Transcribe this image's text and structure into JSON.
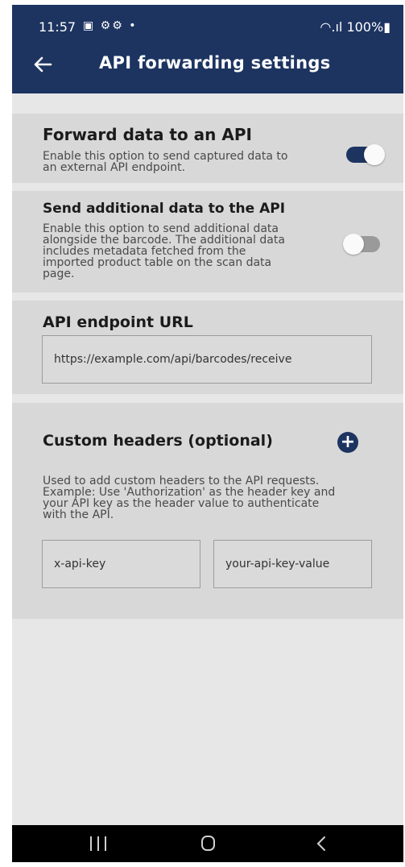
{
  "status_bar": {
    "time": "11:57",
    "icons": "▣ ⚙⚙ •",
    "right": "◠.ıl 100%▮"
  },
  "app_bar": {
    "title": "API forwarding settings"
  },
  "forward": {
    "title": "Forward data to an API",
    "description_lines": [
      "Enable this option to send captured data to",
      "an external API endpoint."
    ],
    "enabled": true
  },
  "additional": {
    "title": "Send additional data to the API",
    "description_lines": [
      "Enable this option to send additional data",
      "alongside the barcode. The additional data",
      "includes metadata fetched from the",
      "imported product table on the scan data",
      "page."
    ],
    "enabled": false
  },
  "endpoint": {
    "title": "API endpoint URL",
    "value": "https://example.com/api/barcodes/receive"
  },
  "headers": {
    "title": "Custom headers (optional)",
    "add_label": "+",
    "description_lines": [
      "Used to add custom headers to the API requests.",
      "Example: Use 'Authorization' as the header key and",
      "your API key as the header value to authenticate",
      "with the API."
    ],
    "key_value": "x-api-key",
    "value_value": "your-api-key-value"
  },
  "colors": {
    "primary": "#1d3461",
    "background": "#e7e7e7",
    "card": "#d8d8d8"
  }
}
